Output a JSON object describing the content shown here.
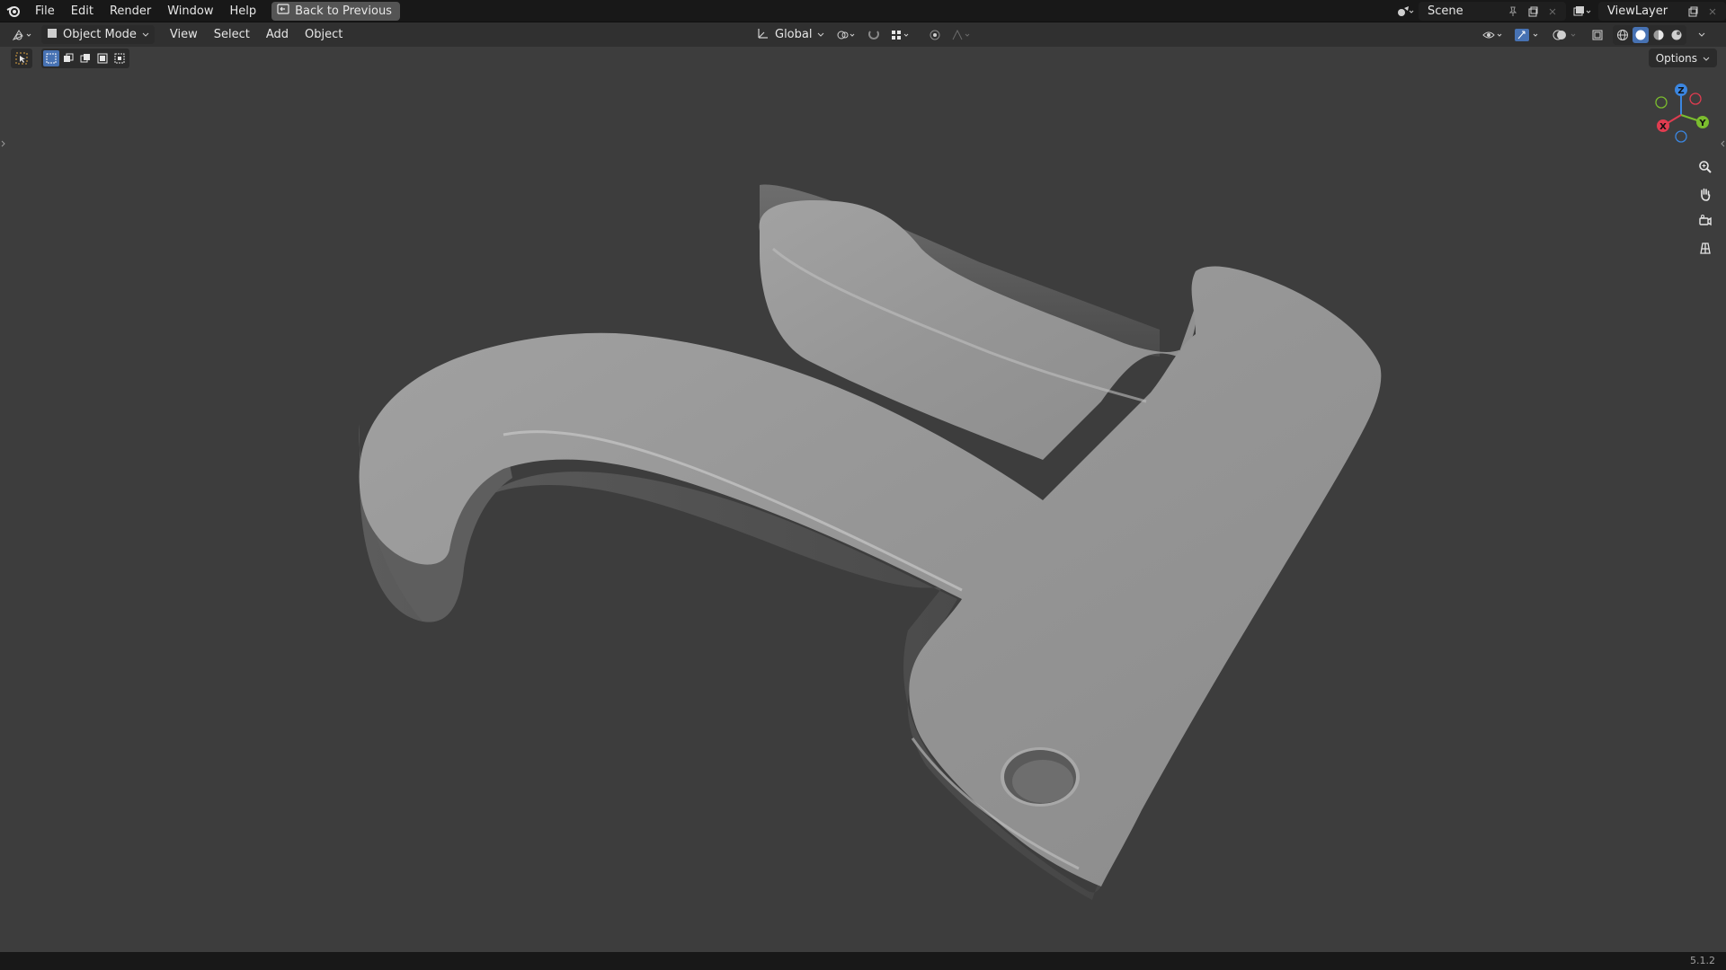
{
  "topbar": {
    "menus": [
      "File",
      "Edit",
      "Render",
      "Window",
      "Help"
    ],
    "back_label": "Back to Previous",
    "scene_name": "Scene",
    "view_layer_name": "ViewLayer"
  },
  "viewport_header": {
    "mode": "Object Mode",
    "menus": [
      "View",
      "Select",
      "Add",
      "Object"
    ],
    "orientation": "Global",
    "options_label": "Options"
  },
  "gizmo": {
    "x": "X",
    "y": "Y",
    "z": "Z"
  },
  "status": {
    "version": "5.1.2"
  },
  "colors": {
    "accent": "#4772b3",
    "axis_x": "#e03c50",
    "axis_y": "#7bbd2e",
    "axis_z": "#3b86e0",
    "background": "#3d3d3d"
  },
  "icons": {
    "logo": "blender-logo-icon",
    "nav": [
      "zoom-icon",
      "pan-hand-icon",
      "camera-icon",
      "ortho-grid-icon"
    ]
  }
}
